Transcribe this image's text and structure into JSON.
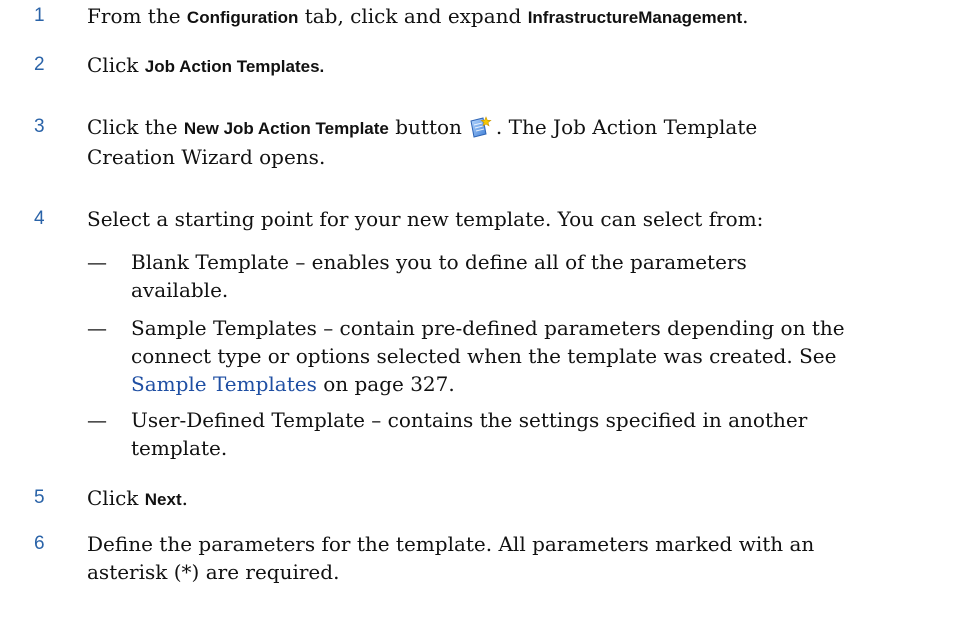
{
  "steps": [
    {
      "number": "1",
      "pre": "From the ",
      "bold1": "Configuration",
      "mid": " tab, click and expand ",
      "bold2": "InfrastructureManagement",
      "post": "."
    },
    {
      "number": "2",
      "pre": "Click ",
      "bold": "Job Action Templates."
    },
    {
      "number": "3",
      "pre": "Click the ",
      "bold": "New Job Action Template",
      "mid": " button",
      "post": ". The Job Action Template",
      "line2": "Creation Wizard opens.",
      "icon": "new-job-action-template-icon"
    },
    {
      "number": "4",
      "text": "Select a starting point for your new template. You can select from:",
      "options": [
        {
          "dash": "—",
          "line1": "Blank Template – enables you to define all of the parameters",
          "line2": "available."
        },
        {
          "dash": "—",
          "line1": "Sample Templates – contain pre-defined parameters depending on the",
          "line2": "connect type or options selected when the template was created. See",
          "link": "Sample Templates",
          "after_link": " on page 327."
        },
        {
          "dash": "—",
          "line1": "User-Defined Template – contains the settings specified in another",
          "line2": "template."
        }
      ]
    },
    {
      "number": "5",
      "pre": "Click ",
      "bold": "Next",
      "post": "."
    },
    {
      "number": "6",
      "line1": "Define the parameters for the template. All parameters marked with an",
      "line2": "asterisk (*) are required."
    }
  ],
  "colors": {
    "step_number": "#2a63a8",
    "link": "#1f4fa3",
    "text": "#111111"
  }
}
